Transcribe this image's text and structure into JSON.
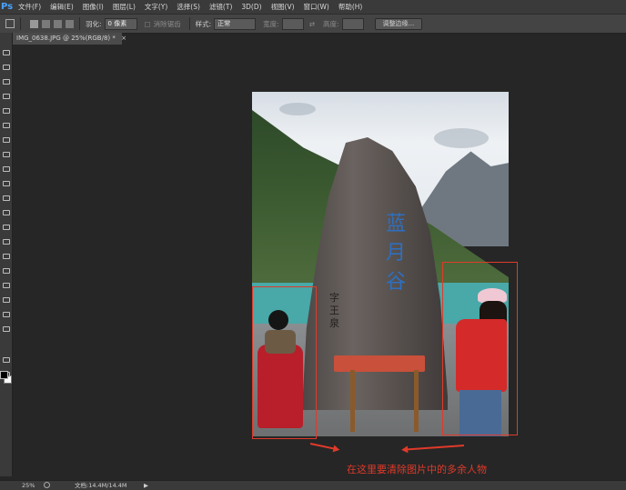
{
  "app": {
    "logo": "Ps"
  },
  "menu": [
    "文件(F)",
    "编辑(E)",
    "图像(I)",
    "图层(L)",
    "文字(Y)",
    "选择(S)",
    "滤镜(T)",
    "3D(D)",
    "视图(V)",
    "窗口(W)",
    "帮助(H)"
  ],
  "options": {
    "feather_label": "羽化:",
    "feather_value": "0 像素",
    "antialias_label": "消除锯齿",
    "style_label": "样式:",
    "style_value": "正常",
    "width_label": "宽度:",
    "height_label": "高度:",
    "refine_button": "调整边缘..."
  },
  "document": {
    "tab_title": "IMG_0638.JPG @ 25%(RGB/8) *",
    "close": "×"
  },
  "photo": {
    "rock_inscription": "蓝月谷",
    "rock_small_text": "字王泉"
  },
  "annotation": {
    "text": "在这里要清除图片中的多余人物"
  },
  "status": {
    "zoom": "25%",
    "doc_info": "文档:14.4M/14.4M",
    "arrow": "▶"
  },
  "colors": {
    "accent_red": "#e03a2a",
    "ps_blue": "#4aa3ff"
  }
}
